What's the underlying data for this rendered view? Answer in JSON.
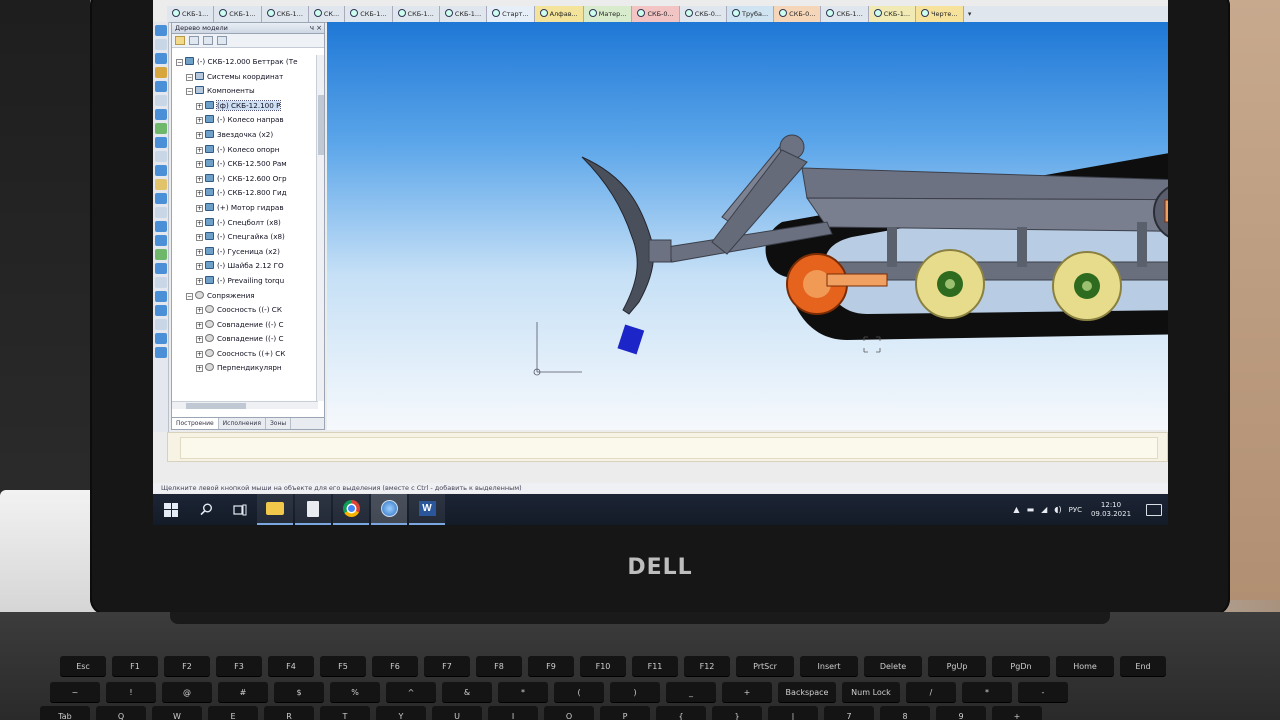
{
  "app": {
    "doc_tabs": [
      "СКБ-1...",
      "СКБ-1...",
      "СКБ-1...",
      "СК...",
      "СКБ-1...",
      "СКБ-1...",
      "СКБ-1...",
      "Старт...",
      "Алфав...",
      "Матер...",
      "СКБ-0...",
      "СКБ-0...",
      "Труба...",
      "СКБ-0...",
      "СКБ-1...",
      "СКБ-1...",
      "Черте..."
    ],
    "tabs_more": "▾"
  },
  "tree": {
    "title": "Дерево модели",
    "pin": "ч",
    "close": "×",
    "items": [
      {
        "label": "(-) СКБ-12.000 Беттрак (Те",
        "type": "root",
        "indent": 0
      },
      {
        "label": "Системы координат",
        "type": "sys",
        "indent": 1
      },
      {
        "label": "Компоненты",
        "type": "sys",
        "indent": 1
      },
      {
        "label": "(ф) СКБ-12.100 Р",
        "type": "part",
        "indent": 2,
        "selected": true
      },
      {
        "label": "(-) Колесо направ",
        "type": "part",
        "indent": 2
      },
      {
        "label": "Звездочка (х2)",
        "type": "part",
        "indent": 2
      },
      {
        "label": "(-) Колесо опорн",
        "type": "part",
        "indent": 2
      },
      {
        "label": "(-) СКБ-12.500 Рам",
        "type": "part",
        "indent": 2
      },
      {
        "label": "(-) СКБ-12.600 Огр",
        "type": "part",
        "indent": 2
      },
      {
        "label": "(-) СКБ-12.800 Гид",
        "type": "part",
        "indent": 2
      },
      {
        "label": "(+) Мотор гидрав",
        "type": "part",
        "indent": 2
      },
      {
        "label": "(-) Спецболт (х8)",
        "type": "part",
        "indent": 2
      },
      {
        "label": "(-) Спецгайка (х8)",
        "type": "part",
        "indent": 2
      },
      {
        "label": "(-) Гусеница (х2)",
        "type": "part",
        "indent": 2
      },
      {
        "label": "(-) Шайба 2.12 ГО",
        "type": "part",
        "indent": 2
      },
      {
        "label": "(-) Prevailing torqu",
        "type": "part",
        "indent": 2
      },
      {
        "label": "Сопряжения",
        "type": "mate",
        "indent": 1
      },
      {
        "label": "Соосность ((-) СК",
        "type": "mate",
        "indent": 2
      },
      {
        "label": "Совпадение ((-) С",
        "type": "mate",
        "indent": 2
      },
      {
        "label": "Совпадение ((-) С",
        "type": "mate",
        "indent": 2
      },
      {
        "label": "Соосность ((+) СК",
        "type": "mate",
        "indent": 2
      },
      {
        "label": "Перпендикулярн",
        "type": "mate",
        "indent": 2
      }
    ],
    "bottom_tabs": [
      "Построение",
      "Исполнения",
      "Зоны"
    ]
  },
  "statusbar": {
    "hint": "Щелкните левой кнопкой мыши на объекте для его выделения (вместе с Ctrl - добавить к выделенным)"
  },
  "taskbar": {
    "search_icon": "search-icon",
    "taskview_icon": "task-view-icon",
    "tray_lang": "РУС",
    "time": "12:10",
    "date": "09.03.2021"
  },
  "laptop": {
    "brand": "DELL"
  },
  "keyboard": {
    "row1": [
      "Esc",
      "F1",
      "F2",
      "F3",
      "F4",
      "F5",
      "F6",
      "F7",
      "F8",
      "F9",
      "F10",
      "F11",
      "F12",
      "PrtScr",
      "Insert",
      "Delete",
      "PgUp",
      "PgDn",
      "Home",
      "End"
    ],
    "row2": [
      "~",
      "!",
      "@",
      "#",
      "$",
      "%",
      "^",
      "&",
      "*",
      "(",
      ")",
      "_",
      "+",
      "Backspace",
      "Num Lock",
      "/",
      "*",
      "-"
    ],
    "row3": [
      "Tab",
      "Q",
      "W",
      "E",
      "R",
      "T",
      "Y",
      "U",
      "I",
      "O",
      "P",
      "{",
      "}",
      "|",
      "7",
      "8",
      "9",
      "+"
    ]
  },
  "colors": {
    "viewport_top": "#1f78d6",
    "viewport_bottom": "#f6f9fc",
    "track": "#0e0e0e",
    "frame": "#6d7283",
    "wheel": "#e6dc8c",
    "hub": "#2e6b1e",
    "idler": "#e5631c",
    "blade_tip": "#1c25c8"
  }
}
